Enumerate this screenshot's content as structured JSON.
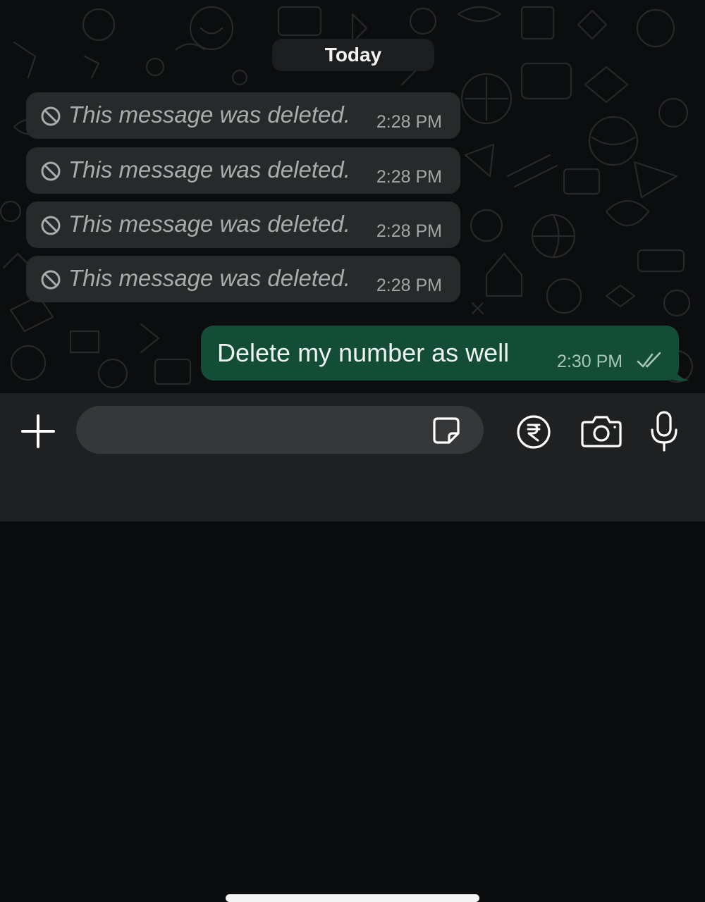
{
  "chat": {
    "date_divider": "Today",
    "incoming": [
      {
        "text": "This message was deleted.",
        "time": "2:28 PM"
      },
      {
        "text": "This message was deleted.",
        "time": "2:28 PM"
      },
      {
        "text": "This message was deleted.",
        "time": "2:28 PM"
      },
      {
        "text": "This message was deleted.",
        "time": "2:28 PM"
      }
    ],
    "outgoing": {
      "text": "Delete my number as well",
      "time": "2:30 PM",
      "status": "double-check-icon"
    }
  },
  "input_bar": {
    "message_value": "",
    "icons": [
      "plus-icon",
      "sticker-icon",
      "rupee-icon",
      "camera-icon",
      "microphone-icon"
    ]
  },
  "colors": {
    "incoming_bubble": "#27292a",
    "outgoing_bubble": "#134d37",
    "input_bar": "#1e2021"
  }
}
